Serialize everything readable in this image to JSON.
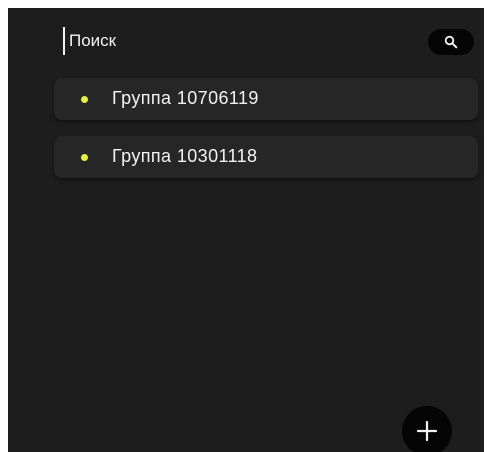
{
  "search": {
    "placeholder": "Поиск",
    "icon": "search-icon"
  },
  "groups": [
    {
      "label": "Группа  10706119",
      "status_color": "#e8f33a"
    },
    {
      "label": "Группа  10301118",
      "status_color": "#e8f33a"
    }
  ],
  "fab": {
    "icon": "plus-icon"
  },
  "colors": {
    "background": "#1d1d1d",
    "item_background": "#262626",
    "button_background": "#050505",
    "text": "#f2f2f2",
    "status_dot": "#e8f33a"
  }
}
